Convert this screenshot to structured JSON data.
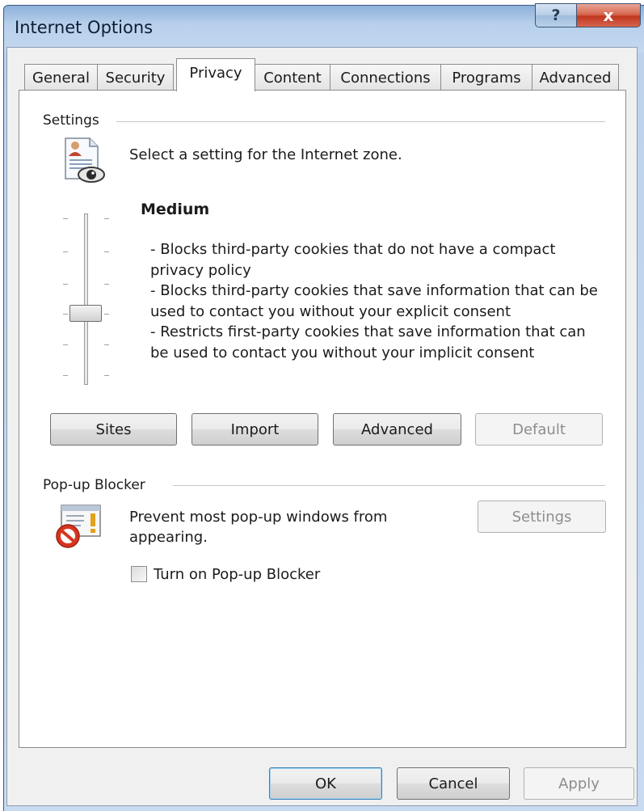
{
  "window": {
    "title": "Internet Options",
    "help_glyph": "?",
    "close_glyph": "x"
  },
  "tabs": [
    {
      "label": "General"
    },
    {
      "label": "Security"
    },
    {
      "label": "Privacy"
    },
    {
      "label": "Content"
    },
    {
      "label": "Connections"
    },
    {
      "label": "Programs"
    },
    {
      "label": "Advanced"
    }
  ],
  "active_tab": "Privacy",
  "settings": {
    "group_label": "Settings",
    "zone_text": "Select a setting for the Internet zone.",
    "level_title": "Medium",
    "level_description": "- Blocks third-party cookies that do not have a compact privacy policy\n- Blocks third-party cookies that save information that can be used to contact you without your explicit consent\n- Restricts first-party cookies that save information that can be used to contact you without your implicit consent",
    "slider_level": 4,
    "slider_positions": 6,
    "buttons": {
      "sites": "Sites",
      "import": "Import",
      "advanced": "Advanced",
      "default": "Default"
    }
  },
  "popup": {
    "group_label": "Pop-up Blocker",
    "text": "Prevent most pop-up windows from\nappearing.",
    "settings_button": "Settings",
    "checkbox_label": "Turn on Pop-up Blocker",
    "checkbox_checked": false
  },
  "footer": {
    "ok": "OK",
    "cancel": "Cancel",
    "apply": "Apply"
  },
  "icons": {
    "zone": "privacy-document-eye-icon",
    "popup": "popup-blocked-icon"
  }
}
